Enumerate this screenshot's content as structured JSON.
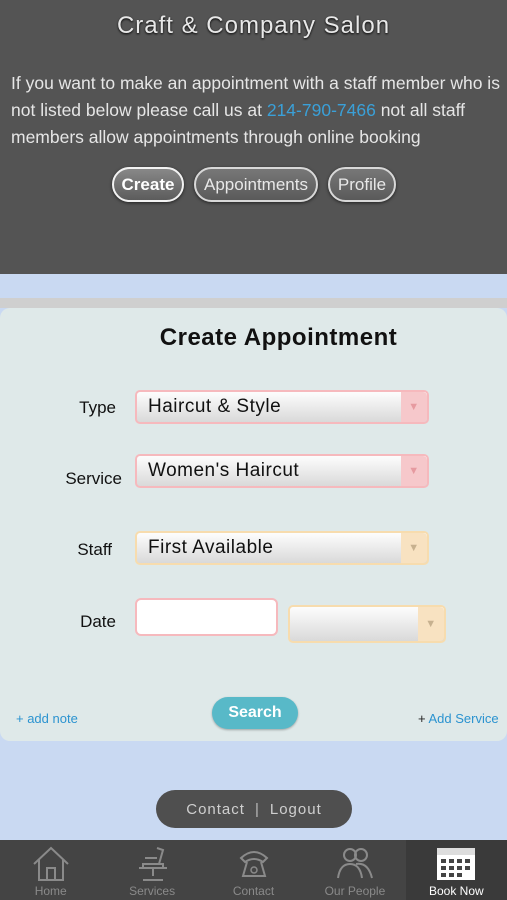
{
  "header": {
    "title": "Craft & Company Salon",
    "intro_before": "If you want to make an appointment with a staff member who is not listed below please call us at ",
    "phone": "214-790-7466",
    "intro_after": " not all staff members allow appointments through online booking",
    "tabs": [
      "Create",
      "Appointments",
      "Profile"
    ]
  },
  "form": {
    "title": "Create Appointment",
    "type_label": "Type",
    "type_value": "Haircut & Style",
    "service_label": "Service",
    "service_value": "Women's Haircut",
    "staff_label": "Staff",
    "staff_value": "First Available",
    "date_label": "Date",
    "date_value": "",
    "time_value": "",
    "add_note": "+ add note",
    "search": "Search",
    "add_service_plus": "+",
    "add_service": "Add Service"
  },
  "footer": {
    "contact": "Contact",
    "separator": "|",
    "logout": "Logout"
  },
  "tabbar": {
    "items": [
      {
        "label": "Home",
        "icon": "house-icon"
      },
      {
        "label": "Services",
        "icon": "barber-chair-icon"
      },
      {
        "label": "Contact",
        "icon": "phone-icon"
      },
      {
        "label": "Our People",
        "icon": "people-icon"
      },
      {
        "label": "Book Now",
        "icon": "calendar-icon"
      }
    ],
    "active": "Book Now"
  },
  "colors": {
    "header_bg": "#545454",
    "link": "#2b93d0",
    "search_button": "#58b9c8",
    "page_bg": "#c9d9f2",
    "card_bg": "#dfe9e9"
  }
}
